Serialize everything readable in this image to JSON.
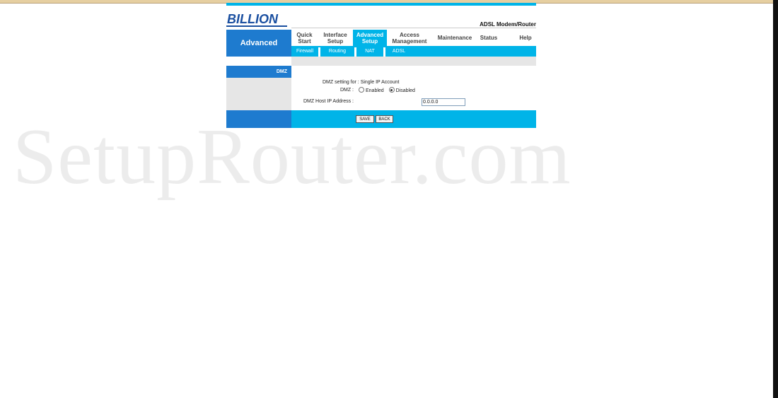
{
  "brand": {
    "logo_text": "BILLION",
    "product": "ADSL Modem/Router"
  },
  "section_title": "Advanced",
  "nav": [
    {
      "line1": "Quick",
      "line2": "Start"
    },
    {
      "line1": "Interface",
      "line2": "Setup"
    },
    {
      "line1": "Advanced",
      "line2": "Setup"
    },
    {
      "line1": "Access",
      "line2": "Management"
    },
    {
      "line1": "Maintenance",
      "line2": ""
    },
    {
      "line1": "Status",
      "line2": ""
    },
    {
      "line1": "Help",
      "line2": ""
    }
  ],
  "subnav": [
    "Firewall",
    "Routing",
    "NAT",
    "ADSL"
  ],
  "side_label": "DMZ",
  "dmz": {
    "setting_label": "DMZ setting for :",
    "setting_value": "Single IP Account",
    "dmz_label": "DMZ :",
    "enabled_label": "Enabled",
    "disabled_label": "Disabled",
    "selected": "Disabled",
    "host_label": "DMZ Host IP Address :",
    "host_value": "0.0.0.0"
  },
  "buttons": {
    "save": "SAVE",
    "back": "BACK"
  },
  "watermark": "SetupRouter.com",
  "colors": {
    "primary_blue": "#1e7bcf",
    "cyan": "#00b4e8",
    "gray": "#e6e6e6"
  }
}
